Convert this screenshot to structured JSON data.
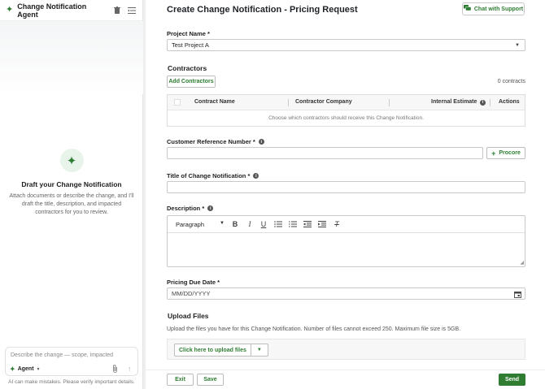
{
  "sidebar": {
    "title": "Change Notification Agent",
    "empty_state": {
      "title": "Draft your Change Notification",
      "text": "Attach documents or describe the change, and I'll draft the title, description, and impacted contractors for you to review."
    },
    "composer": {
      "placeholder": "Describe the change — scope, impacted",
      "agent_label": "Agent"
    },
    "disclaimer": "AI can make mistakes. Please verify important details."
  },
  "header": {
    "title": "Create Change Notification - Pricing Request",
    "chat_button": "Chat with Support"
  },
  "form": {
    "project_name": {
      "label": "Project Name *",
      "value": "Test Project A"
    },
    "contractors": {
      "title": "Contractors",
      "add_button": "Add Contractors",
      "count": "0 contracts",
      "columns": [
        "Contract Name",
        "Contractor Company",
        "Internal Estimate",
        "Actions"
      ],
      "empty_text": "Choose which contractors should receive this Change Notification."
    },
    "customer_ref": {
      "label": "Customer Reference Number *",
      "value": "",
      "procore_button": "Procore"
    },
    "title_field": {
      "label": "Title of Change Notification *",
      "value": ""
    },
    "description": {
      "label": "Description *",
      "paragraph_style": "Paragraph",
      "value": ""
    },
    "due_date": {
      "label": "Pricing Due Date *",
      "placeholder": "MM/DD/YYYY"
    },
    "upload": {
      "title": "Upload Files",
      "help": "Upload the files you have for this Change Notification. Number of files cannot exceed 250. Maximum file size is 5GB.",
      "button": "Click here to upload files"
    }
  },
  "footer": {
    "exit": "Exit",
    "save": "Save",
    "send": "Send"
  },
  "colors": {
    "accent": "#2e7d32"
  }
}
